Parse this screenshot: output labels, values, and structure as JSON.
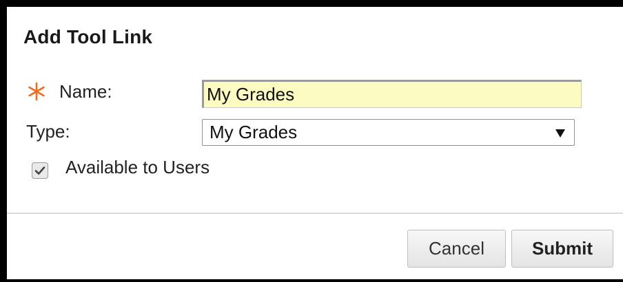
{
  "dialog": {
    "title": "Add Tool Link"
  },
  "form": {
    "name_label": "Name:",
    "name_value": "My Grades",
    "type_label": "Type:",
    "type_selected": "My Grades",
    "available_label": "Available to Users",
    "available_checked": true
  },
  "buttons": {
    "cancel": "Cancel",
    "submit": "Submit"
  },
  "icons": {
    "required": "asterisk-icon",
    "dropdown": "caret-down-icon",
    "check": "checkmark-icon"
  },
  "colors": {
    "required_asterisk": "#f26a1b",
    "name_field_bg": "#fbfbc2"
  }
}
